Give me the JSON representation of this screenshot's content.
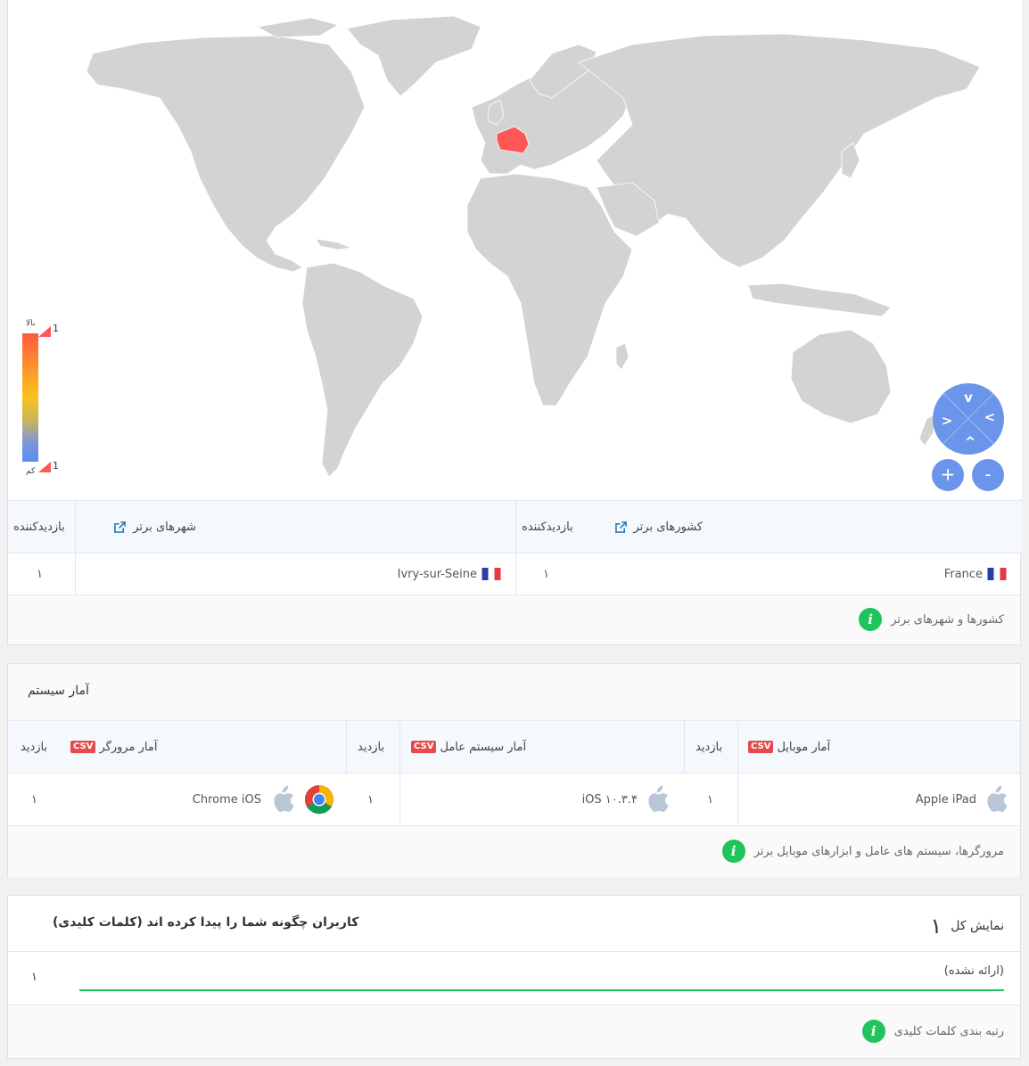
{
  "map": {
    "legend": {
      "high_label": "بالا",
      "low_label": "کم",
      "max": "1",
      "min": "1"
    },
    "highlight": "France",
    "highlight_color": "#ff5757",
    "land_color": "#d3d3d3",
    "nav": {
      "up": "^",
      "down": "v",
      "left": "<",
      "right": ">",
      "zoom_in": "+",
      "zoom_out": "-"
    }
  },
  "geo": {
    "countries_header": "کشورهای برتر",
    "cities_header": "شهرهای برتر",
    "visitors_header_1": "بازدیدکننده",
    "visitors_header_2": "بازدیدکننده",
    "rows": [
      {
        "country": "France",
        "country_visitors": "۱",
        "city": "Ivry-sur-Seine",
        "city_visitors": "۱"
      }
    ],
    "footer": "کشورها و شهرهای برتر"
  },
  "system": {
    "title": "آمار سیستم",
    "mobile_header": "آمار موبایل",
    "os_header": "آمار سیستم عامل",
    "browser_header": "آمار مرورگر",
    "csv_label": "CSV",
    "visit_header": "بازدید",
    "row": {
      "device": "Apple iPad",
      "device_visits": "۱",
      "os": "iOS ۱۰.۳.۴",
      "os_visits": "۱",
      "browser": "Chrome iOS",
      "browser_visits": "۱"
    },
    "footer": "مرورگرها، سیستم های عامل و ابزارهای موبایل برتر"
  },
  "keywords": {
    "total_label": "نمایش کل",
    "total_value": "۱",
    "title": "کاربران چگونه شما را پیدا کرده اند (کلمات کلیدی)",
    "rows": [
      {
        "keyword": "(ارائه نشده)",
        "count": "۱",
        "share": 1.0
      }
    ],
    "bar_color": "#1fc45c",
    "footer": "رتبه بندی کلمات کلیدی"
  }
}
